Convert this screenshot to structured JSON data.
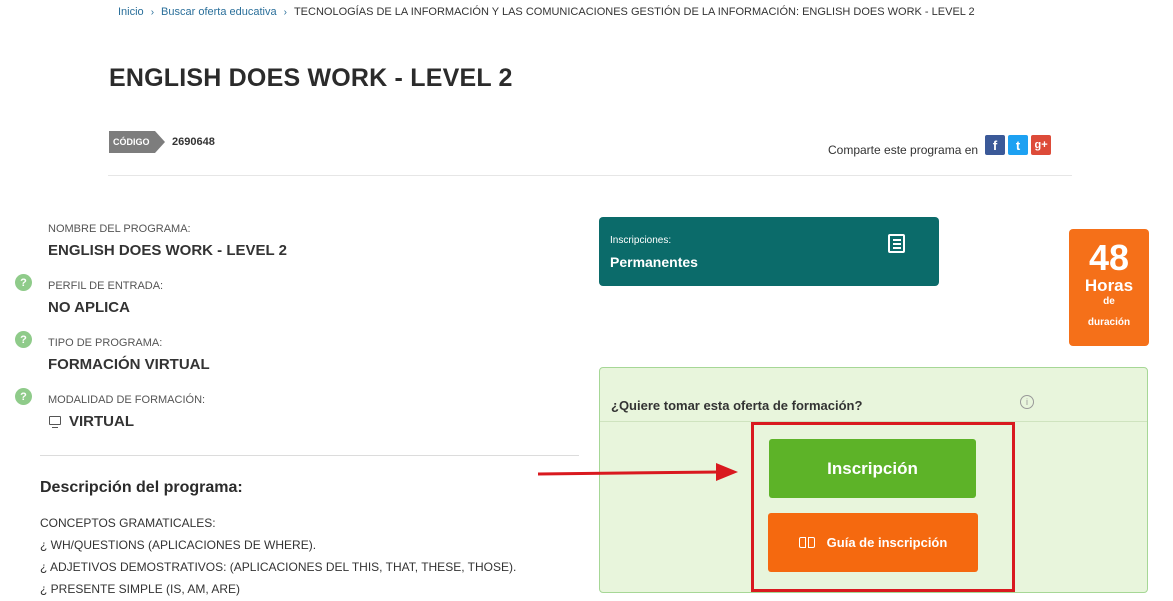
{
  "breadcrumb": {
    "home": "Inicio",
    "search": "Buscar oferta educativa",
    "current": "TECNOLOGÍAS DE LA INFORMACIÓN Y LAS COMUNICACIONES GESTIÓN DE LA INFORMACIÓN: ENGLISH DOES WORK - LEVEL 2"
  },
  "title": "ENGLISH DOES WORK - LEVEL 2",
  "code": {
    "label": "CÓDIGO",
    "value": "2690648"
  },
  "share": {
    "text": "Comparte este programa en",
    "fb": "f",
    "tw": "t",
    "gp": "g+"
  },
  "info": {
    "nombre_label": "NOMBRE DEL PROGRAMA:",
    "nombre_value": "ENGLISH DOES WORK - LEVEL 2",
    "perfil_label": "PERFIL DE ENTRADA:",
    "perfil_value": "NO APLICA",
    "tipo_label": "TIPO DE PROGRAMA:",
    "tipo_value": "FORMACIÓN VIRTUAL",
    "modalidad_label": "MODALIDAD DE FORMACIÓN:",
    "modalidad_value": "VIRTUAL",
    "help_glyph": "?"
  },
  "description": {
    "title": "Descripción del programa:",
    "lines": [
      "CONCEPTOS GRAMATICALES:",
      "¿ WH/QUESTIONS (APLICACIONES DE WHERE).",
      "¿ ADJETIVOS DEMOSTRATIVOS: (APLICACIONES DEL THIS, THAT, THESE, THOSE).",
      "¿ PRESENTE SIMPLE (IS, AM, ARE)"
    ]
  },
  "inscripciones": {
    "label": "Inscripciones:",
    "value": "Permanentes"
  },
  "hours": {
    "number": "48",
    "word": "Horas",
    "de": "de",
    "duracion": "duración"
  },
  "enroll": {
    "question": "¿Quiere tomar esta oferta de formación?",
    "button": "Inscripción",
    "guide_button": "Guía de inscripción"
  },
  "colors": {
    "teal": "#0b6b6a",
    "orange": "#f57019",
    "green": "#5db328",
    "annotation_red": "#d9191f"
  }
}
